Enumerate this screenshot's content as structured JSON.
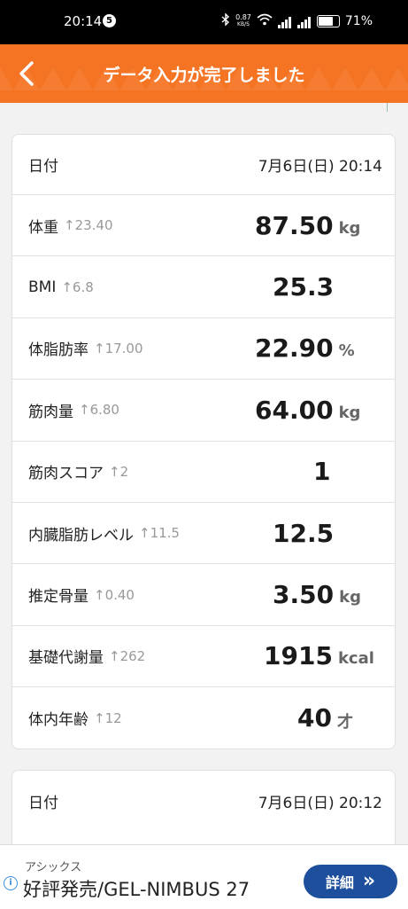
{
  "status": {
    "time": "20:14",
    "notif_count": "5",
    "net_speed": "0.87",
    "net_unit": "KB/S",
    "battery": "71%"
  },
  "header": {
    "title": "データ入力が完了しました"
  },
  "record1": {
    "date_label": "日付",
    "date_value": "7月6日(日) 20:14",
    "rows": [
      {
        "label": "体重",
        "delta": "↑23.40",
        "value": "87.50",
        "unit": "kg"
      },
      {
        "label": "BMI",
        "delta": "↑6.8",
        "value": "25.3",
        "unit": ""
      },
      {
        "label": "体脂肪率",
        "delta": "↑17.00",
        "value": "22.90",
        "unit": "%"
      },
      {
        "label": "筋肉量",
        "delta": "↑6.80",
        "value": "64.00",
        "unit": "kg"
      },
      {
        "label": "筋肉スコア",
        "delta": "↑2",
        "value": "1",
        "unit": ""
      },
      {
        "label": "内臓脂肪レベル",
        "delta": "↑11.5",
        "value": "12.5",
        "unit": ""
      },
      {
        "label": "推定骨量",
        "delta": "↑0.40",
        "value": "3.50",
        "unit": "kg"
      },
      {
        "label": "基礎代謝量",
        "delta": "↑262",
        "value": "1915",
        "unit": "kcal"
      },
      {
        "label": "体内年齢",
        "delta": "↑12",
        "value": "40",
        "unit": "才"
      }
    ]
  },
  "record2": {
    "date_label": "日付",
    "date_value": "7月6日(日) 20:12"
  },
  "ad": {
    "brand": "アシックス",
    "title": "好評発売/GEL-NIMBUS 27",
    "button_label": "詳細",
    "button_arrow": "»"
  },
  "colors": {
    "header": "#f47424",
    "ad_button": "#1d4f9c"
  }
}
